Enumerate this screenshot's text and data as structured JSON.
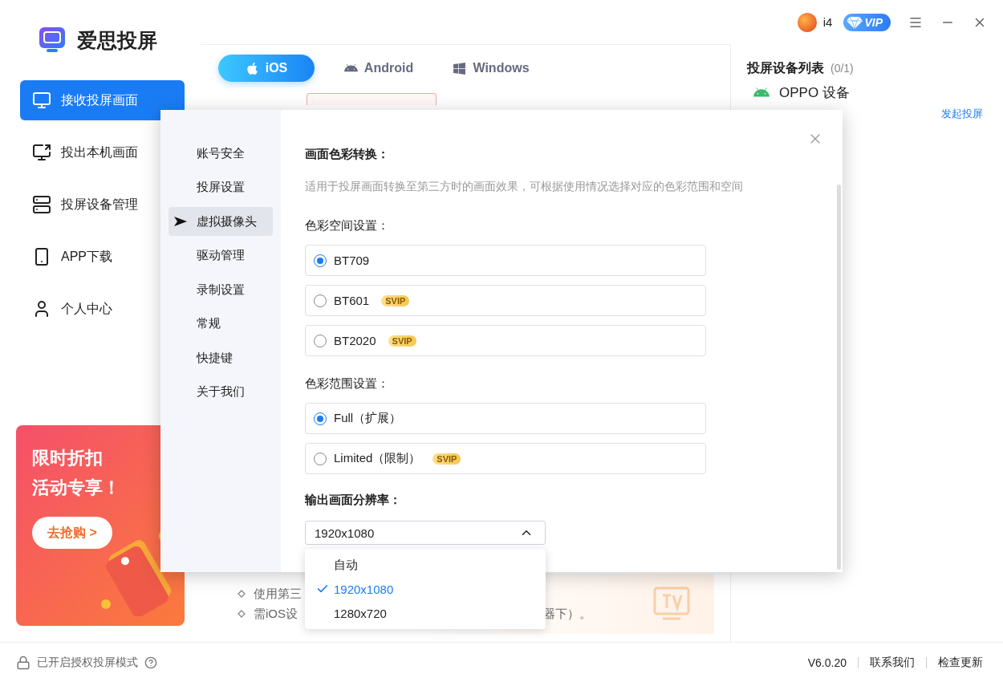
{
  "app": {
    "title": "爱思投屏"
  },
  "user": {
    "name": "i4",
    "badge": "VIP"
  },
  "sidebar": {
    "items": [
      {
        "label": "接收投屏画面",
        "selected": true
      },
      {
        "label": "投出本机画面",
        "selected": false
      },
      {
        "label": "投屏设备管理",
        "selected": false
      },
      {
        "label": "APP下载",
        "selected": false
      },
      {
        "label": "个人中心",
        "selected": false
      }
    ]
  },
  "promo": {
    "lines": [
      "限时折扣",
      "活动专享！"
    ],
    "button": "去抢购 >"
  },
  "platform_tabs": [
    {
      "label": "iOS",
      "selected": true
    },
    {
      "label": "Android",
      "selected": false
    },
    {
      "label": "Windows",
      "selected": false
    }
  ],
  "tips": [
    {
      "fragments": [
        "使用第三"
      ]
    },
    {
      "fragments": [
        "需iOS设",
        "器下）。"
      ]
    }
  ],
  "device_list": {
    "title": "投屏设备列表",
    "count": "(0/1)",
    "devices": [
      {
        "name": "OPPO 设备",
        "action": "发起投屏"
      }
    ]
  },
  "settings_dialog": {
    "nav": [
      {
        "label": "账号安全",
        "selected": false
      },
      {
        "label": "投屏设置",
        "selected": false
      },
      {
        "label": "虚拟摄像头",
        "selected": true
      },
      {
        "label": "驱动管理",
        "selected": false
      },
      {
        "label": "录制设置",
        "selected": false
      },
      {
        "label": "常规",
        "selected": false
      },
      {
        "label": "快捷键",
        "selected": false
      },
      {
        "label": "关于我们",
        "selected": false
      }
    ],
    "heading": "画面色彩转换：",
    "description": "适用于投屏画面转换至第三方时的画面效果，可根据使用情况选择对应的色彩范围和空间",
    "groups": [
      {
        "label": "色彩空间设置：",
        "options": [
          {
            "label": "BT709",
            "selected": true
          },
          {
            "label": "BT601",
            "selected": false,
            "badge": "SVIP"
          },
          {
            "label": "BT2020",
            "selected": false,
            "badge": "SVIP"
          }
        ]
      },
      {
        "label": "色彩范围设置：",
        "options": [
          {
            "label": "Full（扩展）",
            "selected": true
          },
          {
            "label": "Limited（限制）",
            "selected": false,
            "badge": "SVIP"
          }
        ]
      }
    ],
    "resolution": {
      "label": "输出画面分辨率：",
      "value": "1920x1080",
      "expanded": true,
      "options": [
        {
          "label": "自动",
          "selected": false
        },
        {
          "label": "1920x1080",
          "selected": true
        },
        {
          "label": "1280x720",
          "selected": false
        }
      ]
    }
  },
  "status_bar": {
    "mode": "已开启授权投屏模式",
    "version": "V6.0.20",
    "links": [
      "联系我们",
      "检查更新"
    ]
  }
}
